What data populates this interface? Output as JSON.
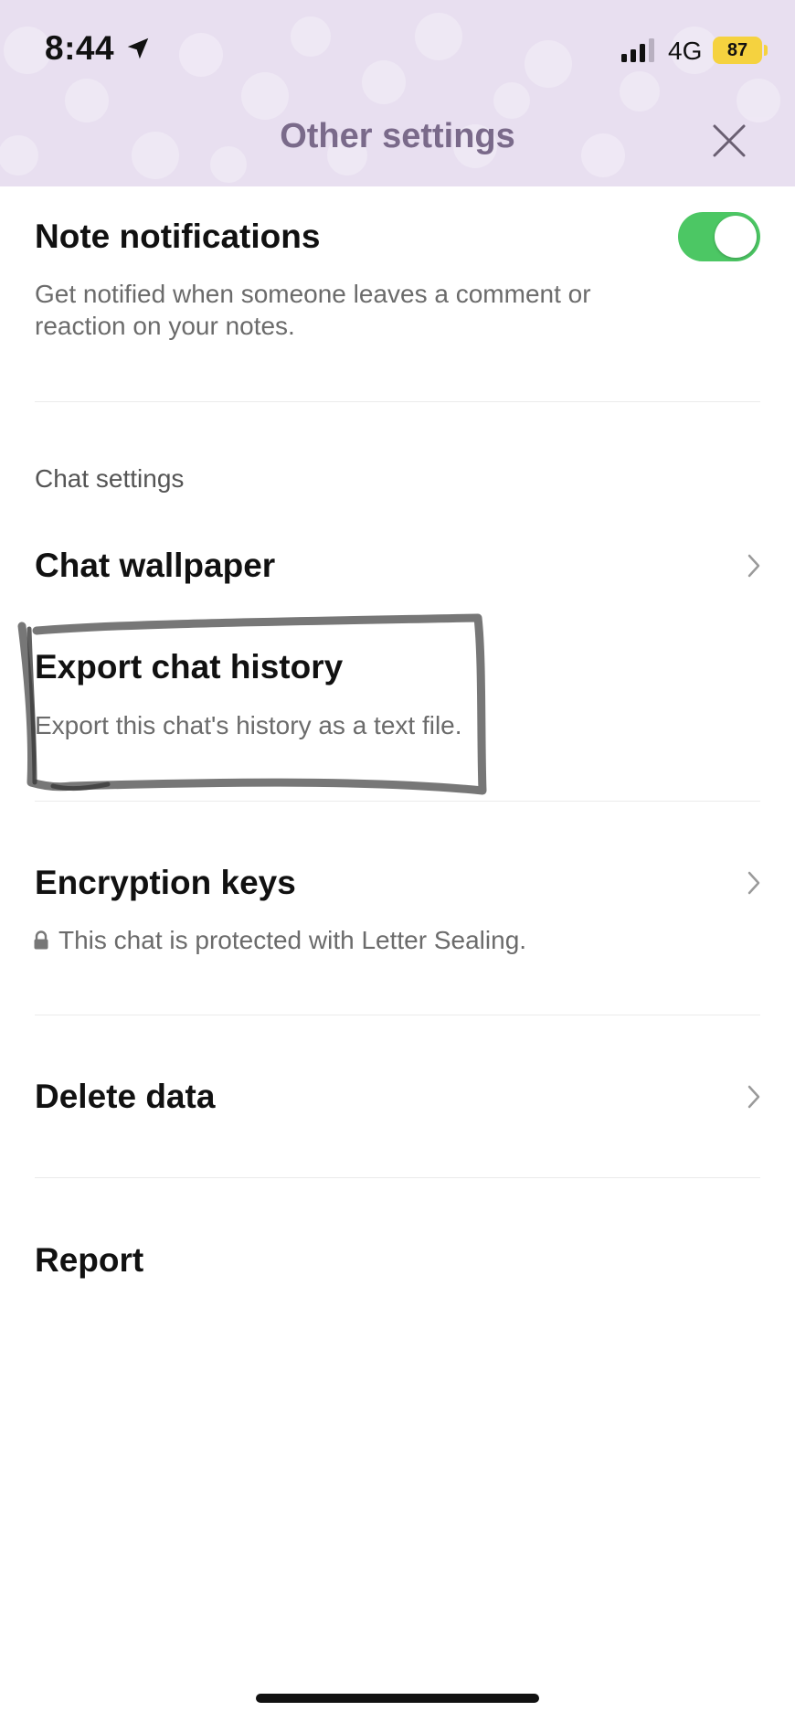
{
  "status_bar": {
    "time": "8:44",
    "network": "4G",
    "battery": "87",
    "icons": [
      "location-arrow-icon",
      "signal-bars-icon"
    ]
  },
  "header": {
    "title": "Other settings",
    "close_icon": "close-icon",
    "background_color": "#e8dff0",
    "title_color": "#7a6a8a"
  },
  "note_notifications": {
    "title": "Note notifications",
    "description_line1": "Get notified when someone leaves a comment or",
    "description_line2": "reaction on your notes.",
    "toggle_on": true,
    "toggle_color": "#4cc764"
  },
  "chat_settings": {
    "section_label": "Chat settings",
    "items": [
      {
        "title": "Chat wallpaper",
        "description": "",
        "has_chevron": true
      },
      {
        "title": "Export chat history",
        "description": "Export this chat's history as a text file.",
        "has_chevron": false
      },
      {
        "title": "Encryption keys",
        "description": "This chat is protected with Letter Sealing.",
        "has_chevron": true,
        "icon": "lock-icon"
      },
      {
        "title": "Delete data",
        "description": "",
        "has_chevron": true
      },
      {
        "title": "Report",
        "description": "",
        "has_chevron": false
      }
    ]
  }
}
